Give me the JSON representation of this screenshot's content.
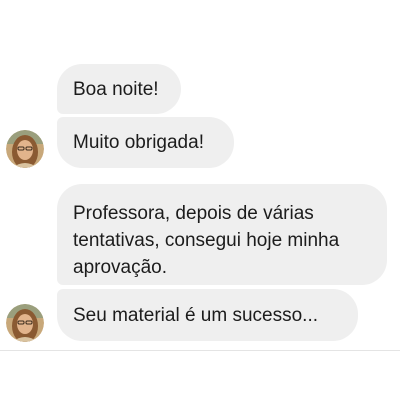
{
  "messages": [
    {
      "text": "Boa noite!"
    },
    {
      "text": "Muito obrigada!"
    },
    {
      "text": "Professora, depois de várias tentativas, consegui hoje minha aprovação."
    },
    {
      "text": "Seu material é  um sucesso..."
    }
  ],
  "colors": {
    "bubble_background": "#efefef",
    "text": "#1c1c1c",
    "page_background": "#ffffff"
  },
  "icons": {
    "avatar": "sender-avatar-photo"
  }
}
